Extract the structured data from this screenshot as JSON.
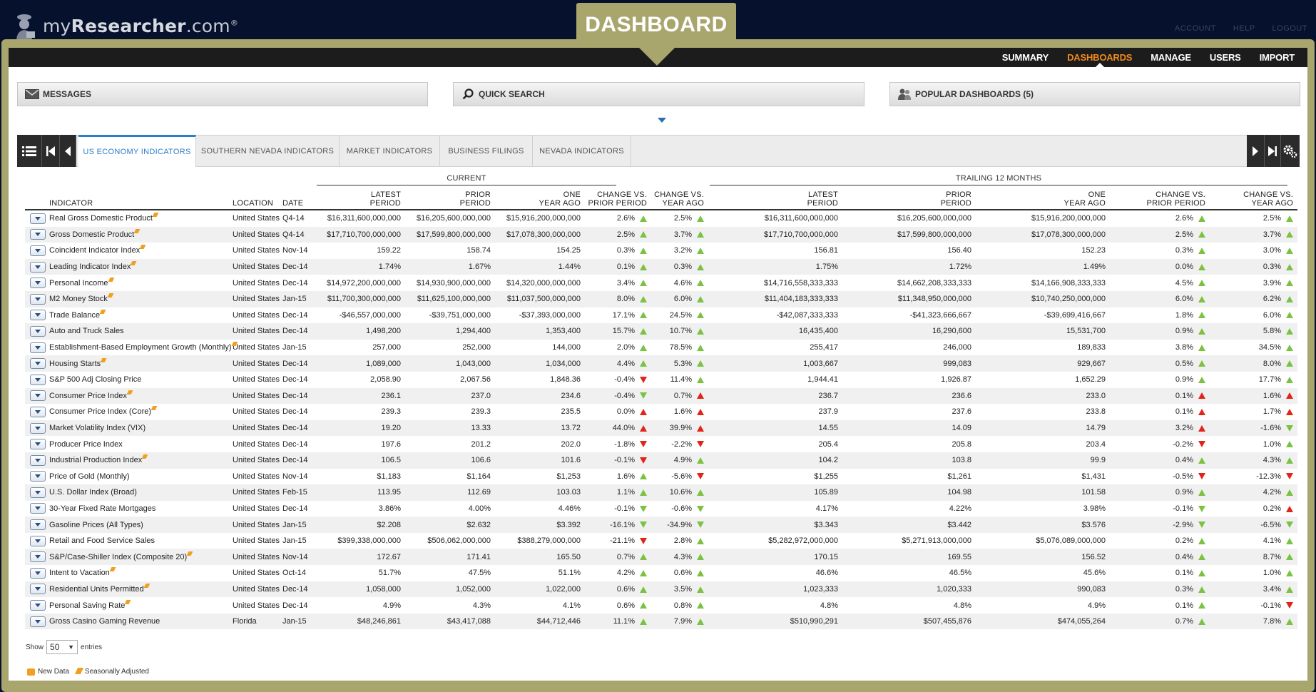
{
  "brand": {
    "name_prefix": "my",
    "name_bold": "Researcher",
    "name_suffix": ".com",
    "registered": "®"
  },
  "top_links": [
    "ACCOUNT",
    "HELP",
    "LOGOUT"
  ],
  "banner": "DASHBOARD",
  "nav": [
    "SUMMARY",
    "DASHBOARDS",
    "MANAGE",
    "USERS",
    "IMPORT"
  ],
  "nav_active": "DASHBOARDS",
  "panels": {
    "messages": "MESSAGES",
    "quick_search": "QUICK SEARCH",
    "popular": "POPULAR DASHBOARDS (5)"
  },
  "tabs": [
    "US ECONOMY INDICATORS",
    "SOUTHERN NEVADA INDICATORS",
    "MARKET INDICATORS",
    "BUSINESS FILINGS",
    "NEVADA INDICATORS"
  ],
  "active_tab": "US ECONOMY INDICATORS",
  "groups": {
    "current": "CURRENT",
    "trailing": "TRAILING 12 MONTHS"
  },
  "columns": {
    "indicator": "INDICATOR",
    "location": "LOCATION",
    "date": "DATE",
    "latest_1": "LATEST",
    "latest_2": "PERIOD",
    "prior_1": "PRIOR",
    "prior_2": "PERIOD",
    "year_1": "ONE",
    "year_2": "YEAR AGO",
    "chg_prior_1": "CHANGE VS.",
    "chg_prior_2": "PRIOR PERIOD",
    "chg_year_1": "CHANGE VS.",
    "chg_year_2": "YEAR AGO"
  },
  "rows": [
    {
      "name": "Real Gross Domestic Product",
      "sa": true,
      "loc": "United States",
      "date": "Q4-14",
      "c": [
        "$16,311,600,000,000",
        "$16,205,600,000,000",
        "$15,916,200,000,000"
      ],
      "cp": "2.6%",
      "cpa": "up-g",
      "cy": "2.5%",
      "cya": "up-g",
      "t": [
        "$16,311,600,000,000",
        "$16,205,600,000,000",
        "$15,916,200,000,000"
      ],
      "tp": "2.6%",
      "tpa": "up-g",
      "ty": "2.5%",
      "tya": "up-g"
    },
    {
      "name": "Gross Domestic Product",
      "sa": true,
      "loc": "United States",
      "date": "Q4-14",
      "c": [
        "$17,710,700,000,000",
        "$17,599,800,000,000",
        "$17,078,300,000,000"
      ],
      "cp": "2.5%",
      "cpa": "up-g",
      "cy": "3.7%",
      "cya": "up-g",
      "t": [
        "$17,710,700,000,000",
        "$17,599,800,000,000",
        "$17,078,300,000,000"
      ],
      "tp": "2.5%",
      "tpa": "up-g",
      "ty": "3.7%",
      "tya": "up-g"
    },
    {
      "name": "Coincident Indicator Index",
      "sa": true,
      "loc": "United States",
      "date": "Nov-14",
      "c": [
        "159.22",
        "158.74",
        "154.25"
      ],
      "cp": "0.3%",
      "cpa": "up-g",
      "cy": "3.2%",
      "cya": "up-g",
      "t": [
        "156.81",
        "156.40",
        "152.23"
      ],
      "tp": "0.3%",
      "tpa": "up-g",
      "ty": "3.0%",
      "tya": "up-g"
    },
    {
      "name": "Leading Indicator Index",
      "sa": true,
      "loc": "United States",
      "date": "Dec-14",
      "c": [
        "1.74%",
        "1.67%",
        "1.44%"
      ],
      "cp": "0.1%",
      "cpa": "up-g",
      "cy": "0.3%",
      "cya": "up-g",
      "t": [
        "1.75%",
        "1.72%",
        "1.49%"
      ],
      "tp": "0.0%",
      "tpa": "up-g",
      "ty": "0.3%",
      "tya": "up-g"
    },
    {
      "name": "Personal Income",
      "sa": true,
      "loc": "United States",
      "date": "Dec-14",
      "c": [
        "$14,972,200,000,000",
        "$14,930,900,000,000",
        "$14,320,000,000,000"
      ],
      "cp": "3.4%",
      "cpa": "up-g",
      "cy": "4.6%",
      "cya": "up-g",
      "t": [
        "$14,716,558,333,333",
        "$14,662,208,333,333",
        "$14,166,908,333,333"
      ],
      "tp": "4.5%",
      "tpa": "up-g",
      "ty": "3.9%",
      "tya": "up-g"
    },
    {
      "name": "M2 Money Stock",
      "sa": true,
      "loc": "United States",
      "date": "Jan-15",
      "c": [
        "$11,700,300,000,000",
        "$11,625,100,000,000",
        "$11,037,500,000,000"
      ],
      "cp": "8.0%",
      "cpa": "up-g",
      "cy": "6.0%",
      "cya": "up-g",
      "t": [
        "$11,404,183,333,333",
        "$11,348,950,000,000",
        "$10,740,250,000,000"
      ],
      "tp": "6.0%",
      "tpa": "up-g",
      "ty": "6.2%",
      "tya": "up-g"
    },
    {
      "name": "Trade Balance",
      "sa": true,
      "loc": "United States",
      "date": "Dec-14",
      "c": [
        "-$46,557,000,000",
        "-$39,751,000,000",
        "-$37,393,000,000"
      ],
      "cp": "17.1%",
      "cpa": "up-g",
      "cy": "24.5%",
      "cya": "up-g",
      "t": [
        "-$42,087,333,333",
        "-$41,323,666,667",
        "-$39,699,416,667"
      ],
      "tp": "1.8%",
      "tpa": "up-g",
      "ty": "6.0%",
      "tya": "up-g"
    },
    {
      "name": "Auto and Truck Sales",
      "sa": false,
      "loc": "United States",
      "date": "Dec-14",
      "c": [
        "1,498,200",
        "1,294,400",
        "1,353,400"
      ],
      "cp": "15.7%",
      "cpa": "up-g",
      "cy": "10.7%",
      "cya": "up-g",
      "t": [
        "16,435,400",
        "16,290,600",
        "15,531,700"
      ],
      "tp": "0.9%",
      "tpa": "up-g",
      "ty": "5.8%",
      "tya": "up-g"
    },
    {
      "name": "Establishment-Based Employment Growth (Monthly)",
      "sa": true,
      "loc": "United States",
      "date": "Jan-15",
      "c": [
        "257,000",
        "252,000",
        "144,000"
      ],
      "cp": "2.0%",
      "cpa": "up-g",
      "cy": "78.5%",
      "cya": "up-g",
      "t": [
        "255,417",
        "246,000",
        "189,833"
      ],
      "tp": "3.8%",
      "tpa": "up-g",
      "ty": "34.5%",
      "tya": "up-g"
    },
    {
      "name": "Housing Starts",
      "sa": true,
      "loc": "United States",
      "date": "Dec-14",
      "c": [
        "1,089,000",
        "1,043,000",
        "1,034,000"
      ],
      "cp": "4.4%",
      "cpa": "up-g",
      "cy": "5.3%",
      "cya": "up-g",
      "t": [
        "1,003,667",
        "999,083",
        "929,667"
      ],
      "tp": "0.5%",
      "tpa": "up-g",
      "ty": "8.0%",
      "tya": "up-g"
    },
    {
      "name": "S&P 500 Adj Closing Price",
      "sa": false,
      "loc": "United States",
      "date": "Dec-14",
      "c": [
        "2,058.90",
        "2,067.56",
        "1,848.36"
      ],
      "cp": "-0.4%",
      "cpa": "dn-r",
      "cy": "11.4%",
      "cya": "up-g",
      "t": [
        "1,944.41",
        "1,926.87",
        "1,652.29"
      ],
      "tp": "0.9%",
      "tpa": "up-g",
      "ty": "17.7%",
      "tya": "up-g"
    },
    {
      "name": "Consumer Price Index",
      "sa": true,
      "loc": "United States",
      "date": "Dec-14",
      "c": [
        "236.1",
        "237.0",
        "234.6"
      ],
      "cp": "-0.4%",
      "cpa": "dn-g",
      "cy": "0.7%",
      "cya": "up-r",
      "t": [
        "236.7",
        "236.6",
        "233.0"
      ],
      "tp": "0.1%",
      "tpa": "up-r",
      "ty": "1.6%",
      "tya": "up-r"
    },
    {
      "name": "Consumer Price Index (Core)",
      "sa": true,
      "loc": "United States",
      "date": "Dec-14",
      "c": [
        "239.3",
        "239.3",
        "235.5"
      ],
      "cp": "0.0%",
      "cpa": "up-r",
      "cy": "1.6%",
      "cya": "up-r",
      "t": [
        "237.9",
        "237.6",
        "233.8"
      ],
      "tp": "0.1%",
      "tpa": "up-r",
      "ty": "1.7%",
      "tya": "up-r"
    },
    {
      "name": "Market Volatility Index (VIX)",
      "sa": false,
      "loc": "United States",
      "date": "Dec-14",
      "c": [
        "19.20",
        "13.33",
        "13.72"
      ],
      "cp": "44.0%",
      "cpa": "up-r",
      "cy": "39.9%",
      "cya": "up-r",
      "t": [
        "14.55",
        "14.09",
        "14.79"
      ],
      "tp": "3.2%",
      "tpa": "up-r",
      "ty": "-1.6%",
      "tya": "dn-g"
    },
    {
      "name": "Producer Price Index",
      "sa": false,
      "loc": "United States",
      "date": "Dec-14",
      "c": [
        "197.6",
        "201.2",
        "202.0"
      ],
      "cp": "-1.8%",
      "cpa": "dn-r",
      "cy": "-2.2%",
      "cya": "dn-r",
      "t": [
        "205.4",
        "205.8",
        "203.4"
      ],
      "tp": "-0.2%",
      "tpa": "dn-r",
      "ty": "1.0%",
      "tya": "up-g"
    },
    {
      "name": "Industrial Production Index",
      "sa": true,
      "loc": "United States",
      "date": "Dec-14",
      "c": [
        "106.5",
        "106.6",
        "101.6"
      ],
      "cp": "-0.1%",
      "cpa": "dn-r",
      "cy": "4.9%",
      "cya": "up-g",
      "t": [
        "104.2",
        "103.8",
        "99.9"
      ],
      "tp": "0.4%",
      "tpa": "up-g",
      "ty": "4.3%",
      "tya": "up-g"
    },
    {
      "name": "Price of Gold (Monthly)",
      "sa": false,
      "loc": "United States",
      "date": "Nov-14",
      "c": [
        "$1,183",
        "$1,164",
        "$1,253"
      ],
      "cp": "1.6%",
      "cpa": "up-g",
      "cy": "-5.6%",
      "cya": "dn-r",
      "t": [
        "$1,255",
        "$1,261",
        "$1,431"
      ],
      "tp": "-0.5%",
      "tpa": "dn-r",
      "ty": "-12.3%",
      "tya": "dn-r"
    },
    {
      "name": "U.S. Dollar Index (Broad)",
      "sa": false,
      "loc": "United States",
      "date": "Feb-15",
      "c": [
        "113.95",
        "112.69",
        "103.03"
      ],
      "cp": "1.1%",
      "cpa": "up-g",
      "cy": "10.6%",
      "cya": "up-g",
      "t": [
        "105.89",
        "104.98",
        "101.58"
      ],
      "tp": "0.9%",
      "tpa": "up-g",
      "ty": "4.2%",
      "tya": "up-g"
    },
    {
      "name": "30-Year Fixed Rate Mortgages",
      "sa": false,
      "loc": "United States",
      "date": "Dec-14",
      "c": [
        "3.86%",
        "4.00%",
        "4.46%"
      ],
      "cp": "-0.1%",
      "cpa": "dn-g",
      "cy": "-0.6%",
      "cya": "dn-g",
      "t": [
        "4.17%",
        "4.22%",
        "3.98%"
      ],
      "tp": "-0.1%",
      "tpa": "dn-g",
      "ty": "0.2%",
      "tya": "up-r"
    },
    {
      "name": "Gasoline Prices (All Types)",
      "sa": false,
      "loc": "United States",
      "date": "Jan-15",
      "c": [
        "$2.208",
        "$2.632",
        "$3.392"
      ],
      "cp": "-16.1%",
      "cpa": "dn-g",
      "cy": "-34.9%",
      "cya": "dn-g",
      "t": [
        "$3.343",
        "$3.442",
        "$3.576"
      ],
      "tp": "-2.9%",
      "tpa": "dn-g",
      "ty": "-6.5%",
      "tya": "dn-g"
    },
    {
      "name": "Retail and Food Service Sales",
      "sa": false,
      "loc": "United States",
      "date": "Jan-15",
      "c": [
        "$399,338,000,000",
        "$506,062,000,000",
        "$388,279,000,000"
      ],
      "cp": "-21.1%",
      "cpa": "dn-r",
      "cy": "2.8%",
      "cya": "up-g",
      "t": [
        "$5,282,972,000,000",
        "$5,271,913,000,000",
        "$5,076,089,000,000"
      ],
      "tp": "0.2%",
      "tpa": "up-g",
      "ty": "4.1%",
      "tya": "up-g"
    },
    {
      "name": "S&P/Case-Shiller Index (Composite 20)",
      "sa": true,
      "loc": "United States",
      "date": "Nov-14",
      "c": [
        "172.67",
        "171.41",
        "165.50"
      ],
      "cp": "0.7%",
      "cpa": "up-g",
      "cy": "4.3%",
      "cya": "up-g",
      "t": [
        "170.15",
        "169.55",
        "156.52"
      ],
      "tp": "0.4%",
      "tpa": "up-g",
      "ty": "8.7%",
      "tya": "up-g"
    },
    {
      "name": "Intent to Vacation",
      "sa": true,
      "loc": "United States",
      "date": "Oct-14",
      "c": [
        "51.7%",
        "47.5%",
        "51.1%"
      ],
      "cp": "4.2%",
      "cpa": "up-g",
      "cy": "0.6%",
      "cya": "up-g",
      "t": [
        "46.6%",
        "46.5%",
        "45.6%"
      ],
      "tp": "0.1%",
      "tpa": "up-g",
      "ty": "1.0%",
      "tya": "up-g"
    },
    {
      "name": "Residential Units Permitted",
      "sa": true,
      "loc": "United States",
      "date": "Dec-14",
      "c": [
        "1,058,000",
        "1,052,000",
        "1,022,000"
      ],
      "cp": "0.6%",
      "cpa": "up-g",
      "cy": "3.5%",
      "cya": "up-g",
      "t": [
        "1,023,333",
        "1,020,333",
        "990,083"
      ],
      "tp": "0.3%",
      "tpa": "up-g",
      "ty": "3.4%",
      "tya": "up-g"
    },
    {
      "name": "Personal Saving Rate",
      "sa": true,
      "loc": "United States",
      "date": "Dec-14",
      "c": [
        "4.9%",
        "4.3%",
        "4.1%"
      ],
      "cp": "0.6%",
      "cpa": "up-g",
      "cy": "0.8%",
      "cya": "up-g",
      "t": [
        "4.8%",
        "4.8%",
        "4.9%"
      ],
      "tp": "0.1%",
      "tpa": "up-g",
      "ty": "-0.1%",
      "tya": "dn-r"
    },
    {
      "name": "Gross Casino Gaming Revenue",
      "sa": false,
      "loc": "Florida",
      "date": "Jan-15",
      "c": [
        "$48,246,861",
        "$43,417,088",
        "$44,712,446"
      ],
      "cp": "11.1%",
      "cpa": "up-g",
      "cy": "7.9%",
      "cya": "up-g",
      "t": [
        "$510,990,291",
        "$507,455,876",
        "$474,055,264"
      ],
      "tp": "0.7%",
      "tpa": "up-g",
      "ty": "7.8%",
      "tya": "up-g"
    }
  ],
  "show": {
    "label": "Show",
    "value": "50",
    "suffix": "entries"
  },
  "legend": {
    "new_data": "New Data",
    "seasonally_adjusted": "Seasonally Adjusted"
  },
  "colors": {
    "accent_orange": "#f08a1c",
    "tab_blue": "#2e7ec6",
    "frame": "#a8a66c",
    "up_green": "#7cc242",
    "down_red": "#e2231a"
  }
}
